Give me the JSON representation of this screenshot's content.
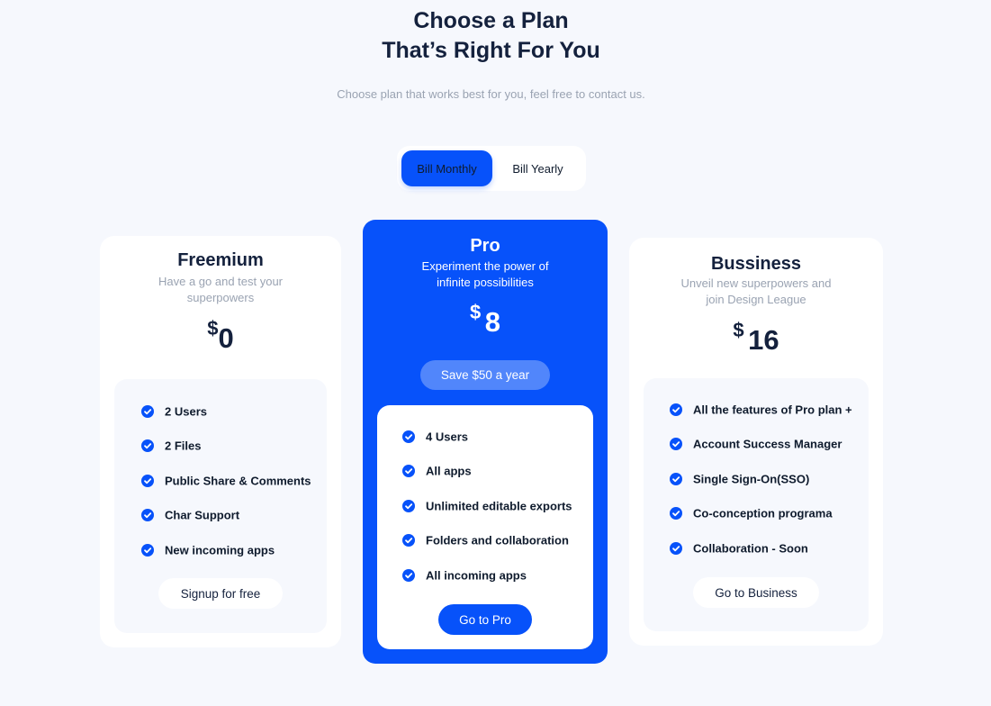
{
  "header": {
    "title_line1": "Choose a Plan",
    "title_line2": "That’s Right For You",
    "subtitle": "Choose plan that works best for you, feel free to contact us."
  },
  "billing_toggle": {
    "monthly_label": "Bill Monthly",
    "yearly_label": "Bill Yearly",
    "selected": "Bill Monthly"
  },
  "plans": [
    {
      "name": "Freemium",
      "description_line1": "Have a go and test your",
      "description_line2": "superpowers",
      "currency": "$",
      "price": "0",
      "features": [
        "2 Users",
        "2 Files",
        "Public Share & Comments",
        "Char Support",
        "New incoming apps"
      ],
      "cta_label": "Signup for free"
    },
    {
      "name": "Pro",
      "description_line1": "Experiment the power of",
      "description_line2": "infinite possibilities",
      "currency": "$",
      "price": "8",
      "badge": "Save $50 a year",
      "features": [
        "4 Users",
        "All apps",
        "Unlimited editable exports",
        "Folders and collaboration",
        "All incoming apps"
      ],
      "cta_label": "Go to Pro"
    },
    {
      "name": "Bussiness",
      "description_line1": "Unveil new superpowers and",
      "description_line2": "join Design League",
      "currency": "$",
      "price": "16",
      "features": [
        "All the features of Pro plan +",
        "Account Success Manager",
        "Single Sign-On(SSO)",
        "Co-conception programa",
        "Collaboration - Soon"
      ],
      "cta_label": "Go to Business"
    }
  ],
  "icons": {
    "feature_check": "check-circle-icon"
  },
  "colors": {
    "accent": "#0752fa",
    "page_background": "#f6f8fd",
    "heading": "#14213d",
    "muted": "#9aa3b2"
  }
}
